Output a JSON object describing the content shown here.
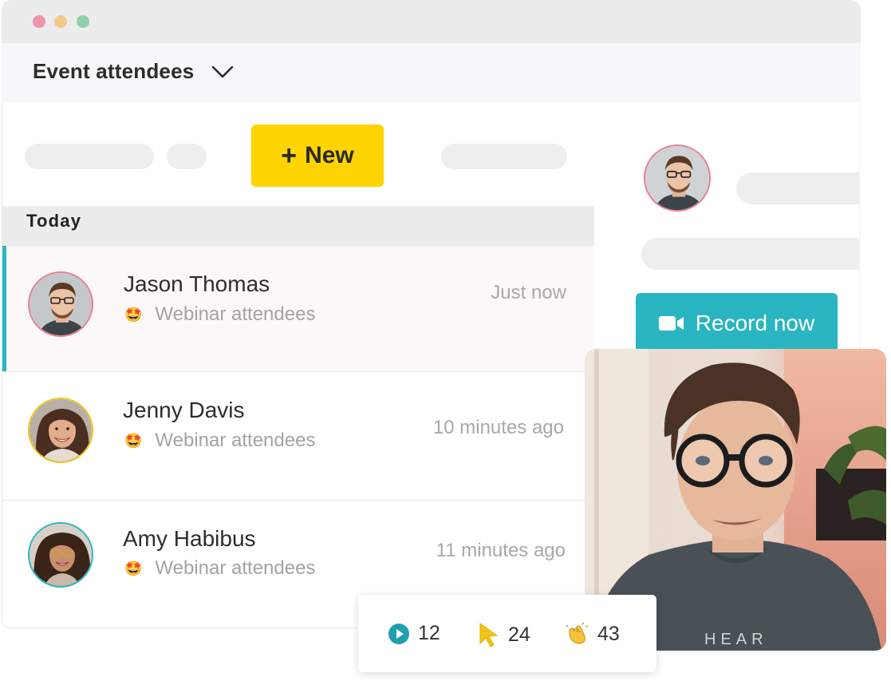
{
  "header": {
    "title": "Event attendees"
  },
  "toolbar": {
    "new_label": "New"
  },
  "section": {
    "title": "Today"
  },
  "attendees": [
    {
      "name": "Jason Thomas",
      "segment": "Webinar attendees",
      "segment_emoji": "🤩",
      "time": "Just now",
      "ring": "#ea7c9a"
    },
    {
      "name": "Jenny Davis",
      "segment": "Webinar attendees",
      "segment_emoji": "🤩",
      "time": "10 minutes ago",
      "ring": "#f2c419"
    },
    {
      "name": "Amy Habibus",
      "segment": "Webinar attendees",
      "segment_emoji": "🤩",
      "time": "11 minutes ago",
      "ring": "#27b7c2"
    }
  ],
  "record": {
    "label": "Record now"
  },
  "stats": {
    "plays": "12",
    "clicks": "24",
    "claps": "43"
  },
  "colors": {
    "accent_yellow": "#ffd400",
    "accent_teal": "#29b5c1",
    "selected_row_bar": "#27b7c2"
  },
  "icons": {
    "dropdown": "chevron-down-icon",
    "record": "video-camera-icon",
    "plays": "play-circle-icon",
    "clicks": "cursor-icon",
    "claps": "clapping-hands-icon"
  }
}
